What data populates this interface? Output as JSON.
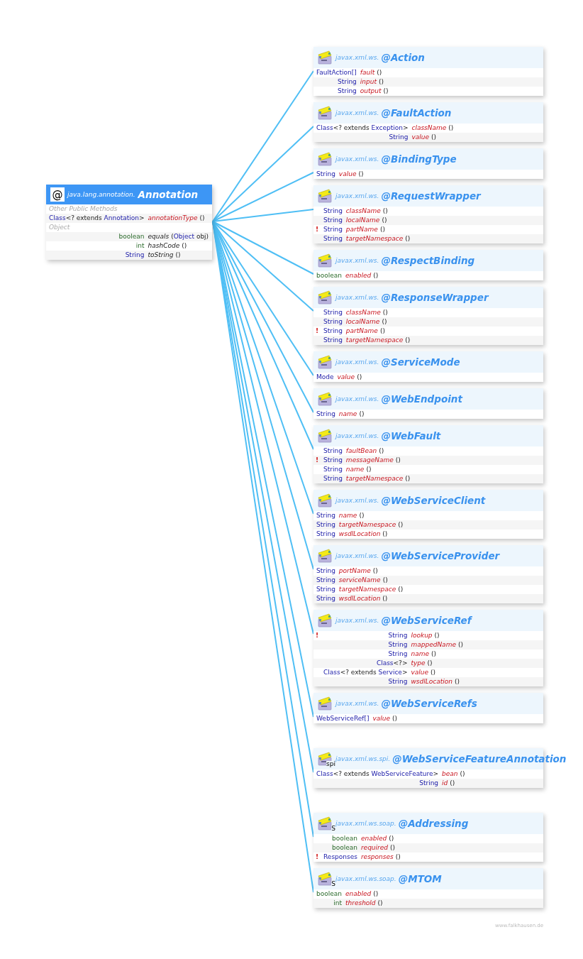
{
  "root": {
    "icon_glyph": "@",
    "package": "java.lang.annotation.",
    "name": "Annotation",
    "rows": [
      {
        "kind": "section",
        "label": "Other Public Methods"
      },
      {
        "kind": "method",
        "type": [
          {
            "text": "Class",
            "kind": "ref"
          },
          {
            "text": "<? extends ",
            "kind": "plain"
          },
          {
            "text": "Annotation",
            "kind": "ref"
          },
          {
            "text": ">",
            "kind": "plain"
          }
        ],
        "name": "annotationType",
        "params": "()",
        "abstract": true
      },
      {
        "kind": "section",
        "label": "Object"
      },
      {
        "kind": "method",
        "type": [
          {
            "text": "boolean",
            "kind": "prim"
          }
        ],
        "name": "equals",
        "params": [
          {
            "text": "(",
            "kind": "plain"
          },
          {
            "text": "Object",
            "kind": "ref"
          },
          {
            "text": " obj)",
            "kind": "plain"
          }
        ],
        "abstract": false
      },
      {
        "kind": "method",
        "type": [
          {
            "text": "int",
            "kind": "prim"
          }
        ],
        "name": "hashCode",
        "params": "()",
        "abstract": false
      },
      {
        "kind": "method",
        "type": [
          {
            "text": "String",
            "kind": "ref"
          }
        ],
        "name": "toString",
        "params": "()",
        "abstract": false
      }
    ]
  },
  "annotations": [
    {
      "package": "javax.xml.ws.",
      "name": "@Action",
      "members": [
        {
          "type": [
            {
              "text": "FaultAction[]",
              "kind": "ref"
            }
          ],
          "name": "fault",
          "params": "()"
        },
        {
          "type": [
            {
              "text": "String",
              "kind": "ref"
            }
          ],
          "name": "input",
          "params": "()"
        },
        {
          "type": [
            {
              "text": "String",
              "kind": "ref"
            }
          ],
          "name": "output",
          "params": "()"
        }
      ]
    },
    {
      "package": "javax.xml.ws.",
      "name": "@FaultAction",
      "members": [
        {
          "type": [
            {
              "text": "Class",
              "kind": "ref"
            },
            {
              "text": "<? extends ",
              "kind": "plain"
            },
            {
              "text": "Exception",
              "kind": "ref"
            },
            {
              "text": ">",
              "kind": "plain"
            }
          ],
          "name": "className",
          "params": "()"
        },
        {
          "type": [
            {
              "text": "String",
              "kind": "ref"
            }
          ],
          "name": "value",
          "params": "()"
        }
      ]
    },
    {
      "package": "javax.xml.ws.",
      "name": "@BindingType",
      "members": [
        {
          "type": [
            {
              "text": "String",
              "kind": "ref"
            }
          ],
          "name": "value",
          "params": "()"
        }
      ]
    },
    {
      "package": "javax.xml.ws.",
      "name": "@RequestWrapper",
      "members": [
        {
          "type": [
            {
              "text": "String",
              "kind": "ref"
            }
          ],
          "name": "className",
          "params": "()"
        },
        {
          "type": [
            {
              "text": "String",
              "kind": "ref"
            }
          ],
          "name": "localName",
          "params": "()"
        },
        {
          "flag": "!",
          "type": [
            {
              "text": "String",
              "kind": "ref"
            }
          ],
          "name": "partName",
          "params": "()"
        },
        {
          "type": [
            {
              "text": "String",
              "kind": "ref"
            }
          ],
          "name": "targetNamespace",
          "params": "()"
        }
      ]
    },
    {
      "package": "javax.xml.ws.",
      "name": "@RespectBinding",
      "members": [
        {
          "type": [
            {
              "text": "boolean",
              "kind": "prim"
            }
          ],
          "name": "enabled",
          "params": "()"
        }
      ]
    },
    {
      "package": "javax.xml.ws.",
      "name": "@ResponseWrapper",
      "members": [
        {
          "type": [
            {
              "text": "String",
              "kind": "ref"
            }
          ],
          "name": "className",
          "params": "()"
        },
        {
          "type": [
            {
              "text": "String",
              "kind": "ref"
            }
          ],
          "name": "localName",
          "params": "()"
        },
        {
          "flag": "!",
          "type": [
            {
              "text": "String",
              "kind": "ref"
            }
          ],
          "name": "partName",
          "params": "()"
        },
        {
          "type": [
            {
              "text": "String",
              "kind": "ref"
            }
          ],
          "name": "targetNamespace",
          "params": "()"
        }
      ]
    },
    {
      "package": "javax.xml.ws.",
      "name": "@ServiceMode",
      "members": [
        {
          "type": [
            {
              "text": "Mode",
              "kind": "ref"
            }
          ],
          "name": "value",
          "params": "()"
        }
      ]
    },
    {
      "package": "javax.xml.ws.",
      "name": "@WebEndpoint",
      "members": [
        {
          "type": [
            {
              "text": "String",
              "kind": "ref"
            }
          ],
          "name": "name",
          "params": "()"
        }
      ]
    },
    {
      "package": "javax.xml.ws.",
      "name": "@WebFault",
      "members": [
        {
          "type": [
            {
              "text": "String",
              "kind": "ref"
            }
          ],
          "name": "faultBean",
          "params": "()"
        },
        {
          "flag": "!",
          "type": [
            {
              "text": "String",
              "kind": "ref"
            }
          ],
          "name": "messageName",
          "params": "()"
        },
        {
          "type": [
            {
              "text": "String",
              "kind": "ref"
            }
          ],
          "name": "name",
          "params": "()"
        },
        {
          "type": [
            {
              "text": "String",
              "kind": "ref"
            }
          ],
          "name": "targetNamespace",
          "params": "()"
        }
      ]
    },
    {
      "package": "javax.xml.ws.",
      "name": "@WebServiceClient",
      "members": [
        {
          "type": [
            {
              "text": "String",
              "kind": "ref"
            }
          ],
          "name": "name",
          "params": "()"
        },
        {
          "type": [
            {
              "text": "String",
              "kind": "ref"
            }
          ],
          "name": "targetNamespace",
          "params": "()"
        },
        {
          "type": [
            {
              "text": "String",
              "kind": "ref"
            }
          ],
          "name": "wsdlLocation",
          "params": "()"
        }
      ]
    },
    {
      "package": "javax.xml.ws.",
      "name": "@WebServiceProvider",
      "members": [
        {
          "type": [
            {
              "text": "String",
              "kind": "ref"
            }
          ],
          "name": "portName",
          "params": "()"
        },
        {
          "type": [
            {
              "text": "String",
              "kind": "ref"
            }
          ],
          "name": "serviceName",
          "params": "()"
        },
        {
          "type": [
            {
              "text": "String",
              "kind": "ref"
            }
          ],
          "name": "targetNamespace",
          "params": "()"
        },
        {
          "type": [
            {
              "text": "String",
              "kind": "ref"
            }
          ],
          "name": "wsdlLocation",
          "params": "()"
        }
      ]
    },
    {
      "package": "javax.xml.ws.",
      "name": "@WebServiceRef",
      "members": [
        {
          "flag": "!",
          "type": [
            {
              "text": "String",
              "kind": "ref"
            }
          ],
          "name": "lookup",
          "params": "()"
        },
        {
          "type": [
            {
              "text": "String",
              "kind": "ref"
            }
          ],
          "name": "mappedName",
          "params": "()"
        },
        {
          "type": [
            {
              "text": "String",
              "kind": "ref"
            }
          ],
          "name": "name",
          "params": "()"
        },
        {
          "type": [
            {
              "text": "Class",
              "kind": "ref"
            },
            {
              "text": "<?>",
              "kind": "plain"
            }
          ],
          "name": "type",
          "params": "()"
        },
        {
          "type": [
            {
              "text": "Class",
              "kind": "ref"
            },
            {
              "text": "<? extends ",
              "kind": "plain"
            },
            {
              "text": "Service",
              "kind": "ref"
            },
            {
              "text": ">",
              "kind": "plain"
            }
          ],
          "name": "value",
          "params": "()"
        },
        {
          "type": [
            {
              "text": "String",
              "kind": "ref"
            }
          ],
          "name": "wsdlLocation",
          "params": "()"
        }
      ]
    },
    {
      "package": "javax.xml.ws.",
      "name": "@WebServiceRefs",
      "members": [
        {
          "type": [
            {
              "text": "WebServiceRef[]",
              "kind": "ref"
            }
          ],
          "name": "value",
          "params": "()"
        }
      ]
    },
    {
      "package": "javax.xml.ws.spi.",
      "name": "@WebServiceFeatureAnnotation",
      "icon_badge": "spi",
      "members": [
        {
          "type": [
            {
              "text": "Class",
              "kind": "ref"
            },
            {
              "text": "<? extends ",
              "kind": "plain"
            },
            {
              "text": "WebServiceFeature",
              "kind": "ref"
            },
            {
              "text": ">",
              "kind": "plain"
            }
          ],
          "name": "bean",
          "params": "()"
        },
        {
          "type": [
            {
              "text": "String",
              "kind": "ref"
            }
          ],
          "name": "id",
          "params": "()"
        }
      ]
    },
    {
      "package": "javax.xml.ws.soap.",
      "name": "@Addressing",
      "icon_badge": "S",
      "members": [
        {
          "type": [
            {
              "text": "boolean",
              "kind": "prim"
            }
          ],
          "name": "enabled",
          "params": "()"
        },
        {
          "type": [
            {
              "text": "boolean",
              "kind": "prim"
            }
          ],
          "name": "required",
          "params": "()"
        },
        {
          "flag": "!",
          "type": [
            {
              "text": "Responses",
              "kind": "ref"
            }
          ],
          "name": "responses",
          "params": "()"
        }
      ]
    },
    {
      "package": "javax.xml.ws.soap.",
      "name": "@MTOM",
      "icon_badge": "S",
      "members": [
        {
          "type": [
            {
              "text": "boolean",
              "kind": "prim"
            }
          ],
          "name": "enabled",
          "params": "()"
        },
        {
          "type": [
            {
              "text": "int",
              "kind": "prim"
            }
          ],
          "name": "threshold",
          "params": "()"
        }
      ]
    }
  ],
  "footer": "www.falkhausen.de"
}
